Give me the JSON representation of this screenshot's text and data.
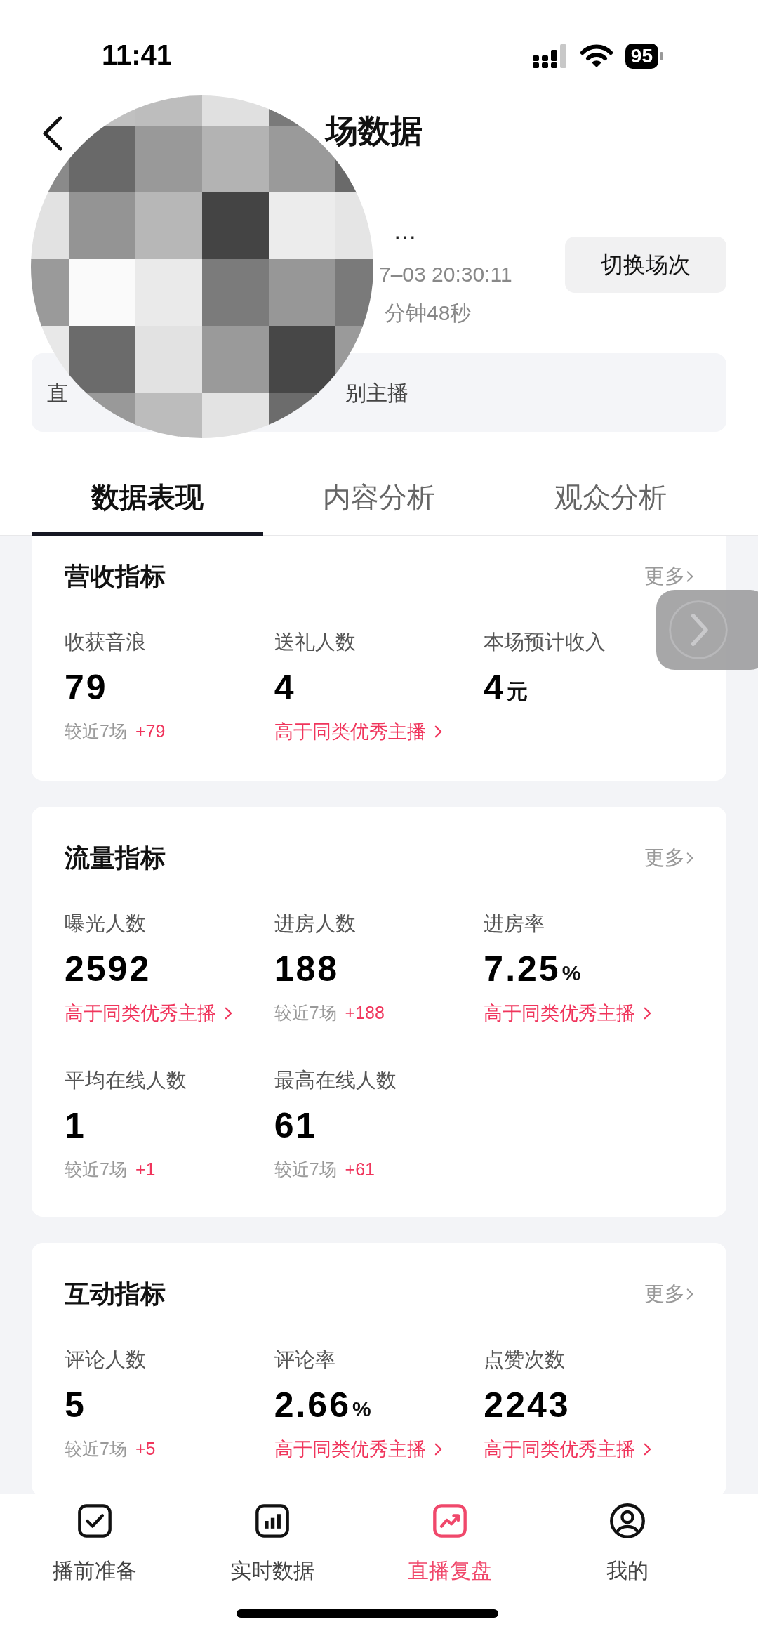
{
  "status_bar": {
    "time": "11:41",
    "battery": "95"
  },
  "header": {
    "title": "场数据",
    "name_fragment": "…",
    "time_fragment": "7–03 20:30:11",
    "duration_fragment": "分钟48秒",
    "switch_button": "切换场次",
    "notice_fragments": [
      "直",
      "别主播"
    ]
  },
  "tabs": [
    {
      "label": "数据表现",
      "selected": true
    },
    {
      "label": "内容分析",
      "selected": false
    },
    {
      "label": "观众分析",
      "selected": false
    }
  ],
  "sections": [
    {
      "title": "营收指标",
      "more": "更多",
      "metrics": [
        {
          "label": "收获音浪",
          "value": "79",
          "kind": "compare",
          "compare": "较近7场",
          "delta": "+79"
        },
        {
          "label": "送礼人数",
          "value": "4",
          "kind": "badge",
          "badge": "高于同类优秀主播"
        },
        {
          "label": "本场预计收入",
          "value": "4",
          "unit": "元",
          "kind": "none"
        }
      ]
    },
    {
      "title": "流量指标",
      "more": "更多",
      "metrics": [
        {
          "label": "曝光人数",
          "value": "2592",
          "kind": "badge",
          "badge": "高于同类优秀主播"
        },
        {
          "label": "进房人数",
          "value": "188",
          "kind": "compare",
          "compare": "较近7场",
          "delta": "+188"
        },
        {
          "label": "进房率",
          "value": "7.25",
          "unit": "%",
          "kind": "badge",
          "badge": "高于同类优秀主播"
        },
        {
          "label": "平均在线人数",
          "value": "1",
          "kind": "compare",
          "compare": "较近7场",
          "delta": "+1"
        },
        {
          "label": "最高在线人数",
          "value": "61",
          "kind": "compare",
          "compare": "较近7场",
          "delta": "+61"
        }
      ]
    },
    {
      "title": "互动指标",
      "more": "更多",
      "metrics": [
        {
          "label": "评论人数",
          "value": "5",
          "kind": "compare",
          "compare": "较近7场",
          "delta": "+5"
        },
        {
          "label": "评论率",
          "value": "2.66",
          "unit": "%",
          "kind": "badge",
          "badge": "高于同类优秀主播"
        },
        {
          "label": "点赞次数",
          "value": "2243",
          "kind": "badge",
          "badge": "高于同类优秀主播"
        }
      ]
    }
  ],
  "nav": [
    {
      "label": "播前准备",
      "selected": false
    },
    {
      "label": "实时数据",
      "selected": false
    },
    {
      "label": "直播复盘",
      "selected": true
    },
    {
      "label": "我的",
      "selected": false
    }
  ]
}
